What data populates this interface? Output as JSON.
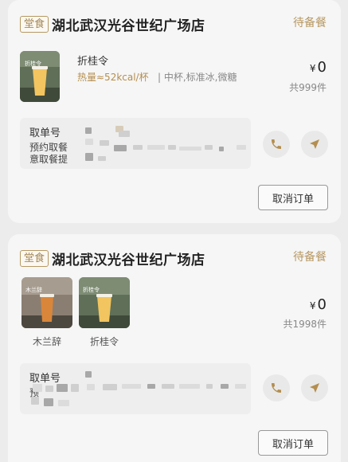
{
  "orders": [
    {
      "dine_tag": "堂食",
      "store_name": "湖北武汉光谷世纪广场店",
      "status": "待备餐",
      "product": {
        "name": "折桂令",
        "calories": "热量≈52kcal/杯",
        "options": "中杯,标准冰,微糖",
        "cup_label": "折桂令"
      },
      "price_symbol": "¥",
      "price_value": "0",
      "count_text": "共999件",
      "pickup": {
        "title": "取单号",
        "line1": "预约取餐",
        "line2": "意取餐提"
      },
      "cancel_label": "取消订单"
    },
    {
      "dine_tag": "堂食",
      "store_name": "湖北武汉光谷世纪广场店",
      "status": "待备餐",
      "products": [
        {
          "name": "木兰辞",
          "cup_label": "木兰辞"
        },
        {
          "name": "折桂令",
          "cup_label": "折桂令"
        }
      ],
      "price_symbol": "¥",
      "price_value": "0",
      "count_text": "共1998件",
      "pickup": {
        "title": "取单号",
        "line1": "预"
      },
      "cancel_label": "取消订单"
    }
  ],
  "icons": {
    "phone": "phone-icon",
    "navigate": "navigation-arrow-icon"
  },
  "colors": {
    "accent": "#b79862",
    "calorie": "#b48e4f",
    "card_bg": "#f6f6f6",
    "page_bg": "#ececec"
  }
}
